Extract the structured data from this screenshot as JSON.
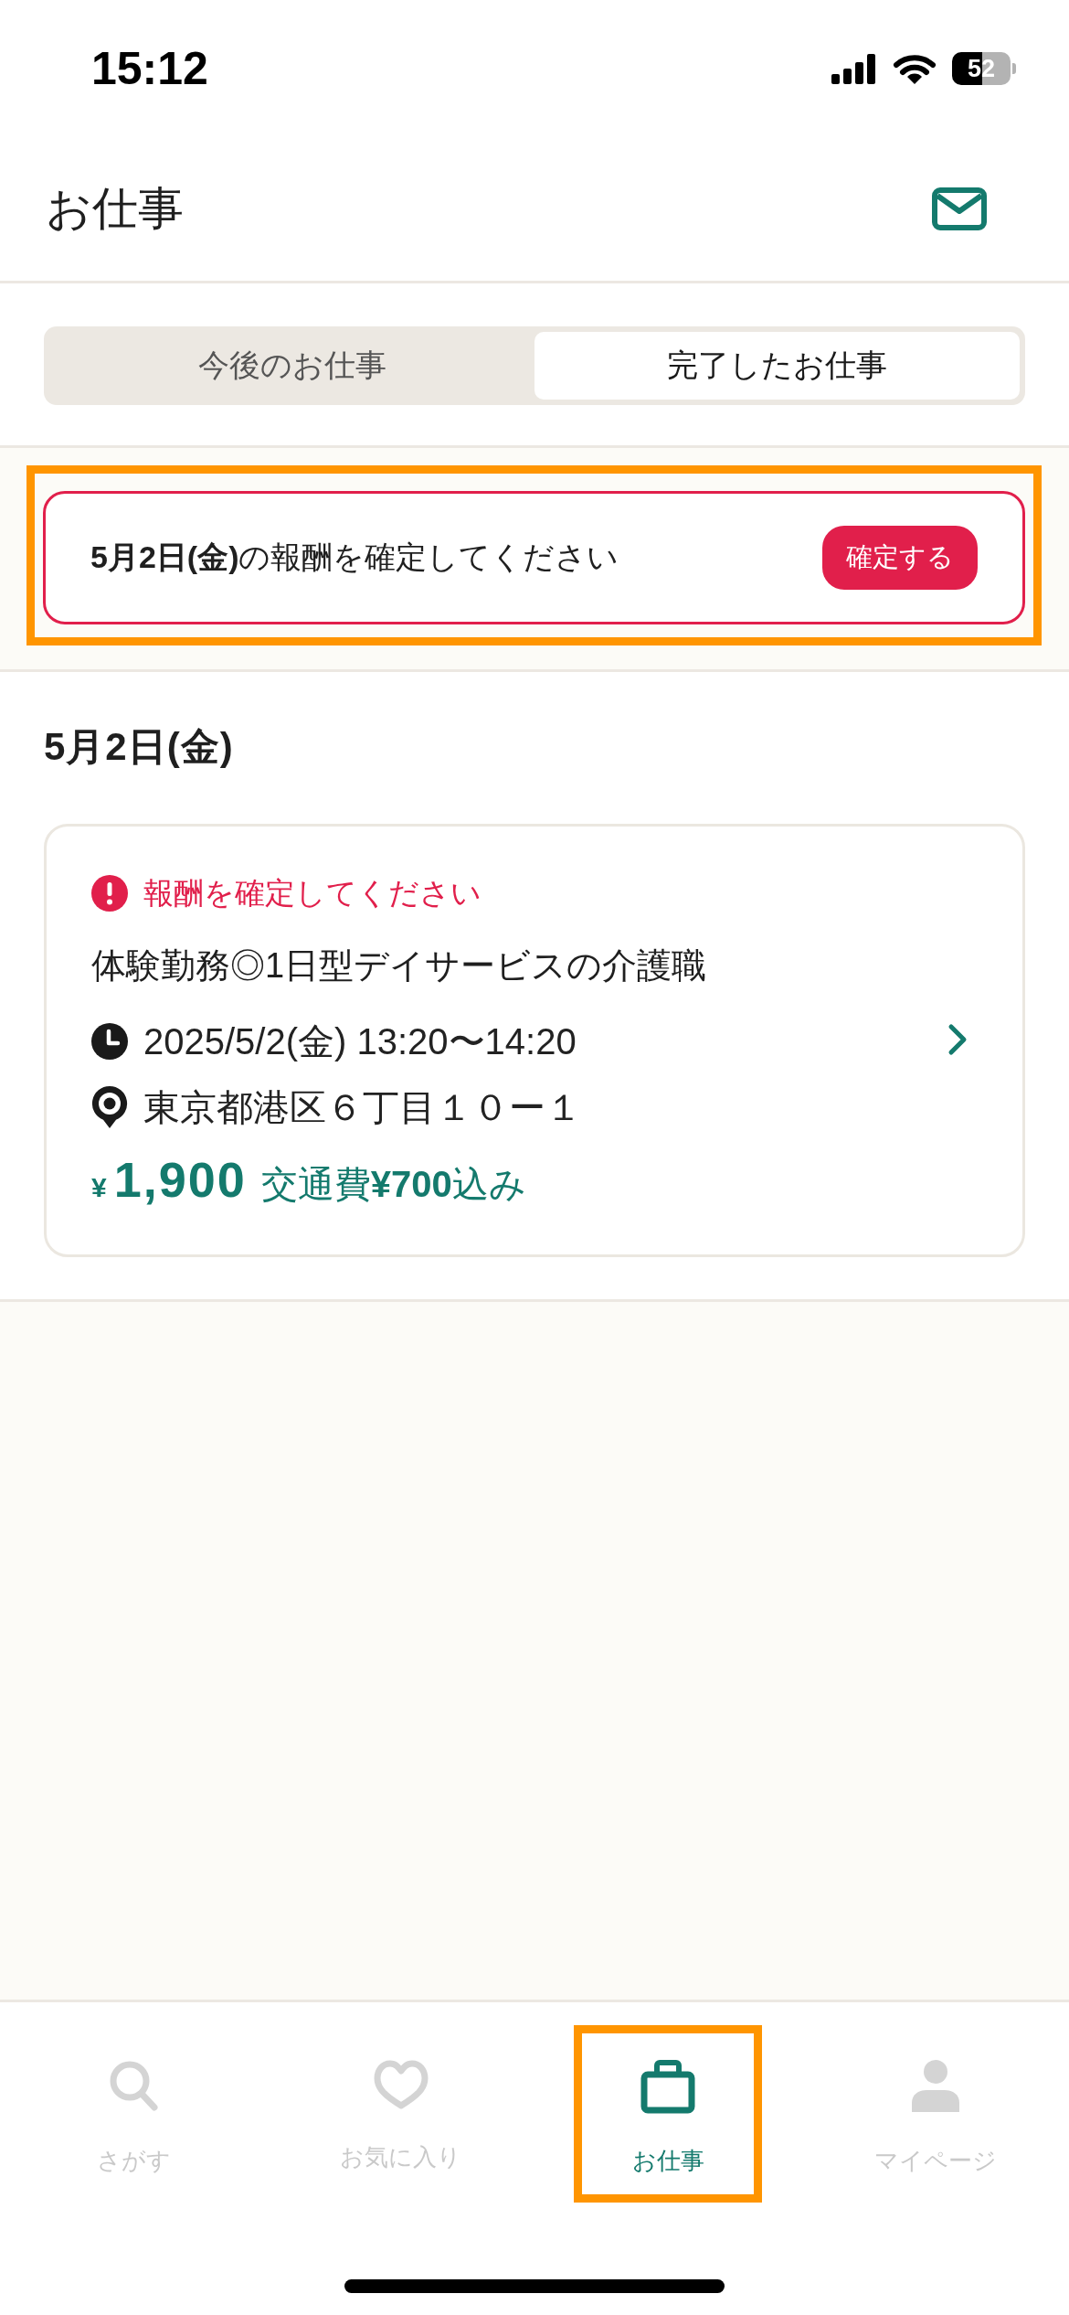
{
  "status_bar": {
    "time": "15:12",
    "battery": "52"
  },
  "header": {
    "title": "お仕事"
  },
  "tabs": [
    {
      "label": "今後のお仕事",
      "selected": false
    },
    {
      "label": "完了したお仕事",
      "selected": true
    }
  ],
  "notice": {
    "highlighted": true,
    "message": "**5月2日(金)**の報酬を確定してください",
    "button": "確定する"
  },
  "jobs": {
    "date": "5月2日(金)",
    "cards": [
      {
        "alert": "報酬を確定してください",
        "title": "体験勤務◎1日型デイサービスの介護職",
        "datetime": "2025/5/2(金) 13:20〜14:20",
        "address": "東京都港区６丁目１０ー１",
        "currency": "¥",
        "amount": "1,900",
        "note": "交通費**¥700**込み"
      }
    ]
  },
  "nav": [
    {
      "kind": "search",
      "label": "さがす",
      "selected": false,
      "highlighted": false
    },
    {
      "kind": "favorites",
      "label": "お気に入り",
      "selected": false,
      "highlighted": false
    },
    {
      "kind": "jobs",
      "label": "お仕事",
      "selected": true,
      "highlighted": true
    },
    {
      "kind": "mypage",
      "label": "マイページ",
      "selected": false,
      "highlighted": false
    }
  ]
}
